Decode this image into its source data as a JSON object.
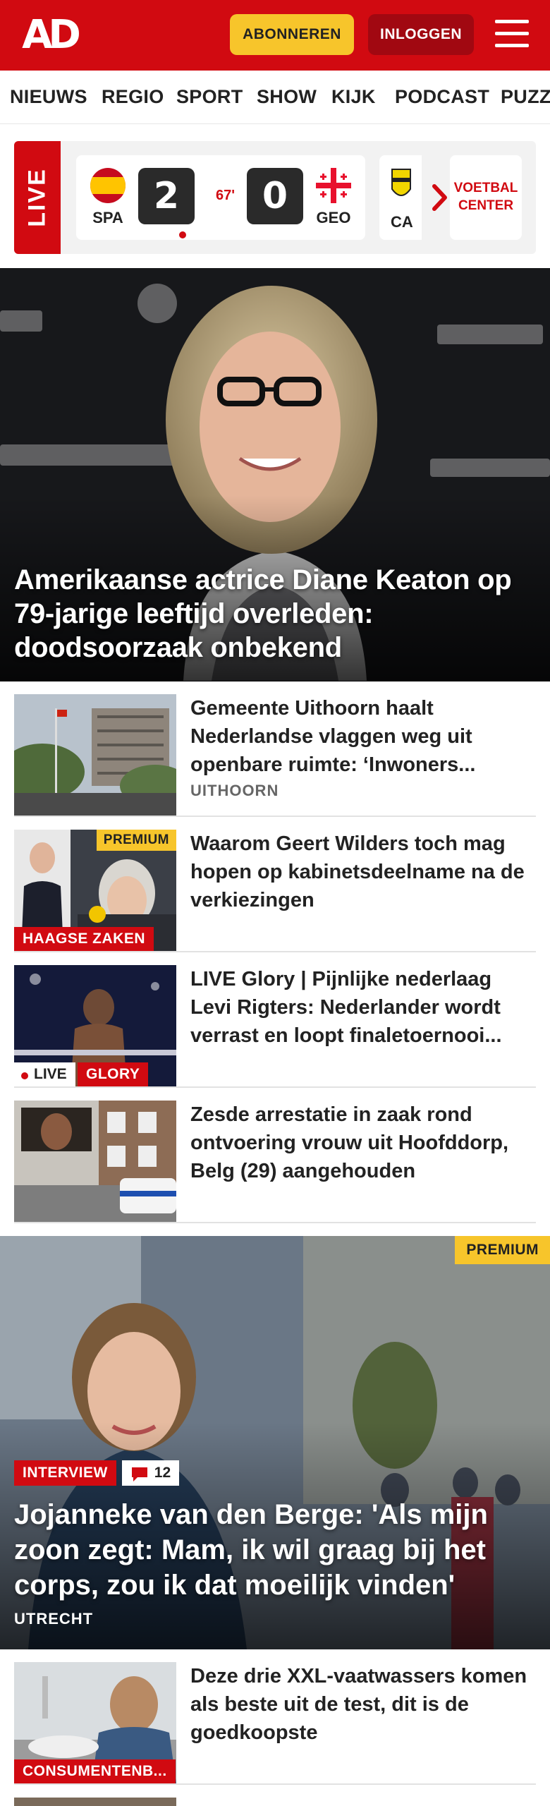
{
  "header": {
    "logo": "AD",
    "subscribe_label": "ABONNEREN",
    "login_label": "INLOGGEN",
    "brand_red": "#d10a11",
    "accent_yellow": "#f7c52b",
    "menu_icon": "hamburger-menu-icon"
  },
  "nav": {
    "items": [
      "NIEUWS",
      "REGIO",
      "SPORT",
      "SHOW",
      "KIJK",
      "PODCAST",
      "PUZZ"
    ]
  },
  "live": {
    "label": "LIVE",
    "match": {
      "home_code": "SPA",
      "home_score": "2",
      "minute": "67'",
      "away_score": "0",
      "away_code": "GEO"
    },
    "next_code": "CA",
    "center_label_1": "VOETBAL",
    "center_label_2": "CENTER"
  },
  "hero": {
    "title": "Amerikaanse actrice Diane Keaton op 79-jarige leeftijd overleden: doodsoorzaak onbekend"
  },
  "articles": [
    {
      "headline": "Gemeente Uithoorn haalt Nederlandse vlaggen weg uit openbare ruimte: ‘Inwoners...",
      "location": "UITHOORN"
    },
    {
      "headline": "Waarom Geert Wilders toch mag hopen op kabinetsdeelname na de verkiezingen",
      "premium": "PREMIUM",
      "tag": "HAAGSE ZAKEN"
    },
    {
      "headline": "LIVE Glory | Pijnlijke nederlaag Levi Rigters: Nederlander wordt verrast en loopt finaletoernooi...",
      "live": "LIVE",
      "tag": "GLORY"
    },
    {
      "headline": "Zesde arrestatie in zaak rond ontvoering vrouw uit Hoofddorp, Belg (29) aangehouden"
    }
  ],
  "feature": {
    "premium": "PREMIUM",
    "tag": "INTERVIEW",
    "comments": "12",
    "title": "Jojanneke van den Berge: 'Als mijn zoon zegt: Mam, ik wil graag bij het corps, zou ik dat moeilijk vinden'",
    "location": "UTRECHT"
  },
  "bottom_articles": [
    {
      "headline": "Deze drie XXL-vaatwassers komen als beste uit de test, dit is de goedkoopste",
      "tag": "CONSUMENTENB..."
    }
  ]
}
